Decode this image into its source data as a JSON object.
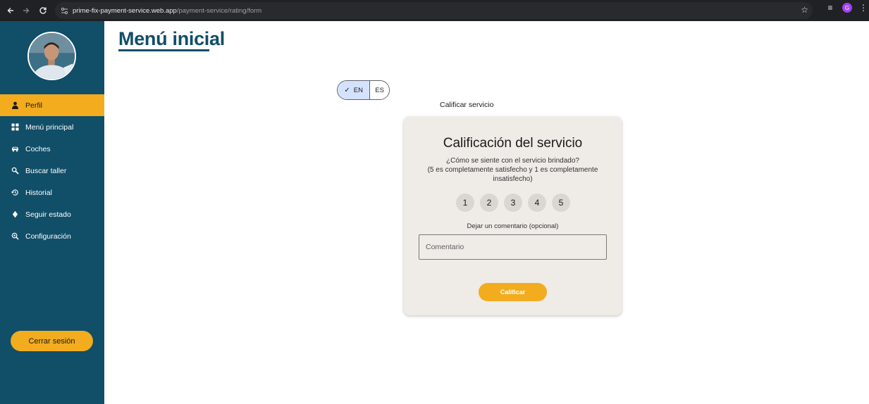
{
  "browser": {
    "url_domain": "prime-fix-payment-service.web.app",
    "url_path": "/payment-service/rating/form",
    "profile_initial": "G",
    "icons": [
      "back-arrow-icon",
      "forward-arrow-icon",
      "reload-icon",
      "site-info-icon",
      "bookmark-star-icon",
      "media-control-icon",
      "profile-avatar",
      "more-menu-icon"
    ]
  },
  "sidebar": {
    "items": [
      {
        "label": "Perfil",
        "icon": "person-icon",
        "active": true
      },
      {
        "label": "Menú principal",
        "icon": "grid-icon",
        "active": false
      },
      {
        "label": "Coches",
        "icon": "car-icon",
        "active": false
      },
      {
        "label": "Buscar taller",
        "icon": "wrench-search-icon",
        "active": false
      },
      {
        "label": "Historial",
        "icon": "history-icon",
        "active": false
      },
      {
        "label": "Seguir estado",
        "icon": "diamond-icon",
        "active": false
      },
      {
        "label": "Configuración",
        "icon": "settings-search-icon",
        "active": false
      }
    ],
    "logout_label": "Cerrar sesión"
  },
  "main": {
    "title": "Menú inicial",
    "language": {
      "options": [
        "EN",
        "ES"
      ],
      "selected": "EN"
    },
    "section_label": "Calificar servicio",
    "card": {
      "title": "Calificación del servicio",
      "question_line1": "¿Cómo se siente con el servicio brindado?",
      "question_line2": "(5 es completamente satisfecho y 1 es completamente insatisfecho)",
      "ratings": [
        "1",
        "2",
        "3",
        "4",
        "5"
      ],
      "comment_label": "Dejar un comentario (opcional)",
      "comment_placeholder": "Comentario",
      "submit_label": "Calificar"
    }
  },
  "colors": {
    "sidebar_bg": "#114e68",
    "accent": "#f2ac1e",
    "card_bg": "#efebe7",
    "title": "#114e68"
  }
}
